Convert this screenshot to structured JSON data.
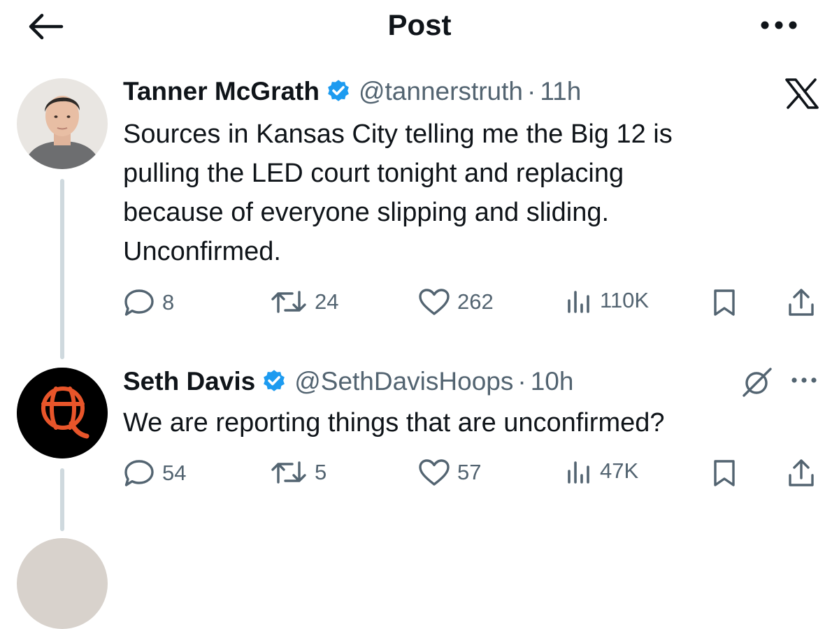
{
  "header": {
    "title": "Post",
    "back_icon": "arrow-left-icon",
    "more_icon": "more-dots-icon"
  },
  "colors": {
    "text": "#0f1419",
    "secondary": "#536471",
    "verified": "#1d9bf0",
    "thread_line": "#cfd9de"
  },
  "posts": [
    {
      "author": {
        "name": "Tanner McGrath",
        "handle": "@tannerstruth",
        "separator": "·",
        "time": "11h",
        "verified": true
      },
      "lines": [
        "Sources in Kansas City telling me the Big 12 is",
        "pulling the LED court tonight and replacing",
        "because of everyone slipping and sliding.",
        "Unconfirmed."
      ],
      "corner_icon": "x-logo-icon",
      "stats": {
        "replies": "8",
        "reposts": "24",
        "likes": "262",
        "views": "110K"
      }
    },
    {
      "author": {
        "name": "Seth Davis",
        "handle": "@SethDavisHoops",
        "separator": "·",
        "time": "10h",
        "verified": true
      },
      "lines": [
        "We are reporting things that are unconfirmed?"
      ],
      "corner_icons": [
        "grok-icon",
        "more-dots-icon"
      ],
      "stats": {
        "replies": "54",
        "reposts": "5",
        "likes": "57",
        "views": "47K"
      }
    }
  ]
}
